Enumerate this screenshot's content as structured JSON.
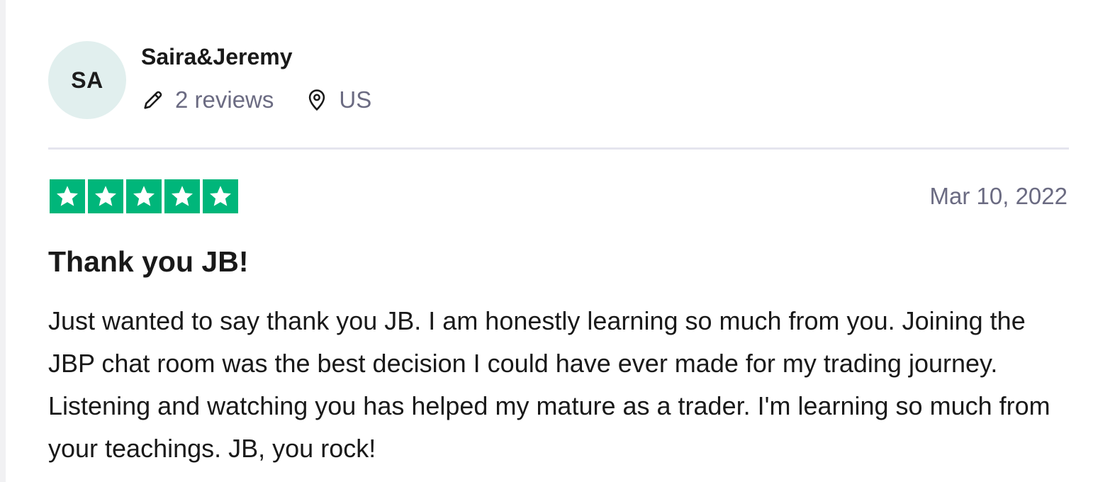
{
  "consumer": {
    "initials": "SA",
    "name": "Saira&Jeremy",
    "reviews_label": "2 reviews",
    "country": "US"
  },
  "review": {
    "rating": 5,
    "rating_max": 5,
    "date": "Mar 10, 2022",
    "title": "Thank you JB!",
    "body": "Just wanted to say thank you JB. I am honestly learning so much from you. Joining the JBP chat room was the best decision I could have ever made for my trading journey. Listening and watching you has helped my mature as a trader. I'm learning so much from your teachings. JB, you rock!"
  },
  "icons": {
    "reviews": "pencil-icon",
    "location": "location-pin-icon",
    "star": "star-icon"
  },
  "colors": {
    "star_green": "#00b67a",
    "avatar_bg": "#e1efee",
    "muted_text": "#6b6b82",
    "divider": "#e5e5ee"
  }
}
